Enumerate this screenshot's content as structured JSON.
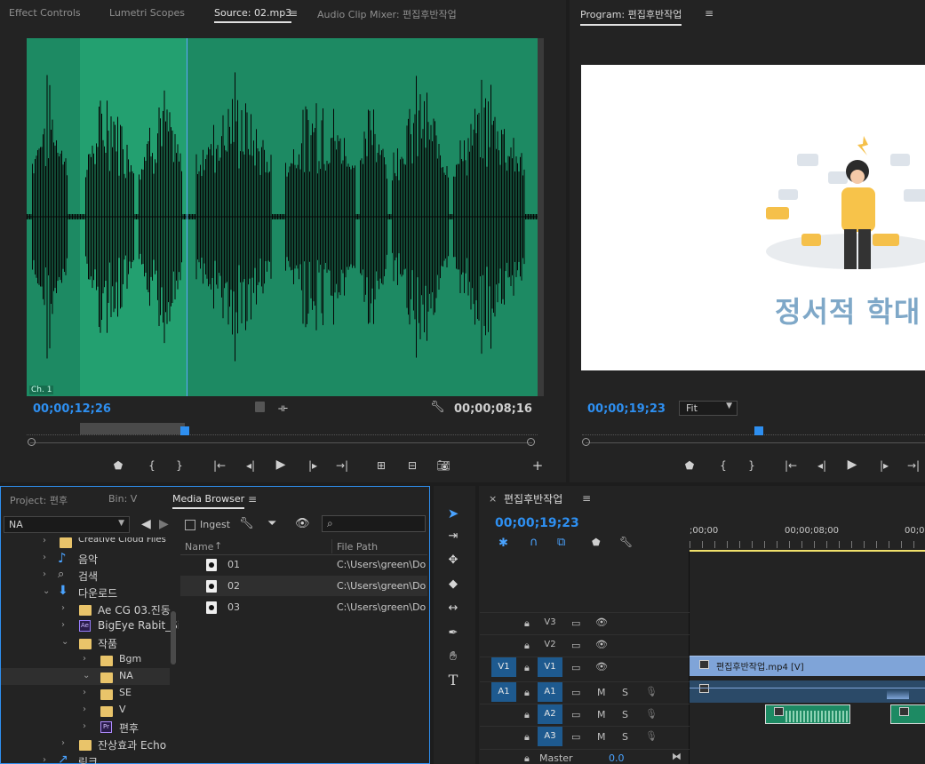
{
  "source_panel": {
    "tabs": [
      "Effect Controls",
      "Lumetri Scopes",
      "Source: 02.mp3",
      "Audio Clip Mixer: 편집후반작업"
    ],
    "channel_label": "Ch. 1",
    "timecode_current": "00;00;12;26",
    "timecode_duration": "00;00;08;16",
    "waveform_color": "#1d8a63",
    "highlight_color": "#23a070"
  },
  "program_panel": {
    "title": "Program: 편집후반작업",
    "timecode": "00;00;19;23",
    "zoom": "Fit",
    "preview_text": "정서적 학대"
  },
  "project_panel": {
    "tabs": [
      "Project: 편후",
      "Bin: V",
      "Media Browser"
    ],
    "location": "NA",
    "ingest_label": "Ingest",
    "tree": [
      {
        "label": "Creative Cloud Files",
        "icon": "folder-icon"
      },
      {
        "label": "음악",
        "icon": "music-icon"
      },
      {
        "label": "검색",
        "icon": "search-icon"
      },
      {
        "label": "다운로드",
        "icon": "download-icon"
      },
      {
        "label": "Ae CG 03.진동",
        "icon": "folder-icon"
      },
      {
        "label": "BigEye Rabit_Si",
        "icon": "ae-icon"
      },
      {
        "label": "작품",
        "icon": "folder-icon"
      },
      {
        "label": "Bgm",
        "icon": "folder-icon"
      },
      {
        "label": "NA",
        "icon": "folder-icon"
      },
      {
        "label": "SE",
        "icon": "folder-icon"
      },
      {
        "label": "V",
        "icon": "folder-icon"
      },
      {
        "label": "편후",
        "icon": "pr-icon"
      },
      {
        "label": "잔상효과 Echo",
        "icon": "folder-icon"
      },
      {
        "label": "링크",
        "icon": "link-icon"
      }
    ],
    "columns": [
      "Name",
      "File Path"
    ],
    "files": [
      {
        "name": "01",
        "path": "C:\\Users\\green\\Dov"
      },
      {
        "name": "02",
        "path": "C:\\Users\\green\\Dov"
      },
      {
        "name": "03",
        "path": "C:\\Users\\green\\Dov"
      }
    ]
  },
  "timeline_panel": {
    "title": "편집후반작업",
    "timecode": "00;00;19;23",
    "ruler": [
      ";00;00",
      "00;00;08;00",
      "00;0"
    ],
    "tracks": [
      {
        "src": "",
        "name": "V3"
      },
      {
        "src": "",
        "name": "V2"
      },
      {
        "src": "V1",
        "name": "V1"
      },
      {
        "src": "A1",
        "name": "A1"
      },
      {
        "src": "",
        "name": "A2"
      },
      {
        "src": "",
        "name": "A3"
      }
    ],
    "mute_label": "M",
    "solo_label": "S",
    "master_label": "Master",
    "master_value": "0.0",
    "video_clip_label": "편집후반작업.mp4 [V]"
  }
}
